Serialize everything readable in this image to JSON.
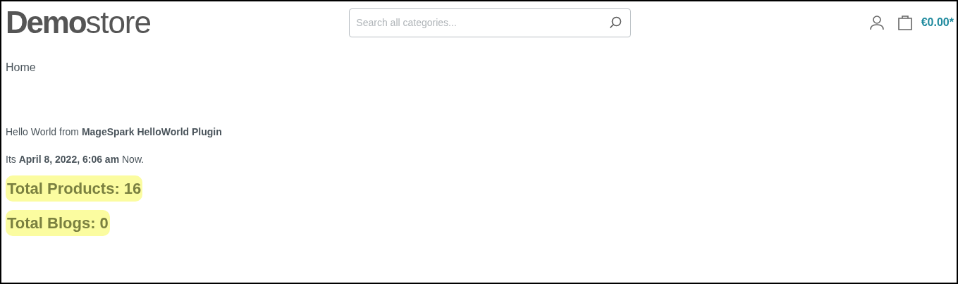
{
  "header": {
    "logo": "**Demo**store",
    "search": {
      "placeholder": "Search all categories..."
    },
    "cart_total": "€0.00*"
  },
  "breadcrumb": "Home",
  "content": {
    "paragraphs": [
      "Hello World from **MageSpark HelloWorld Plugin**",
      "Its **April 8, 2022, 6:06 am** Now."
    ],
    "highlights": [
      "Total Products: 16",
      "Total Blogs: 0"
    ]
  }
}
